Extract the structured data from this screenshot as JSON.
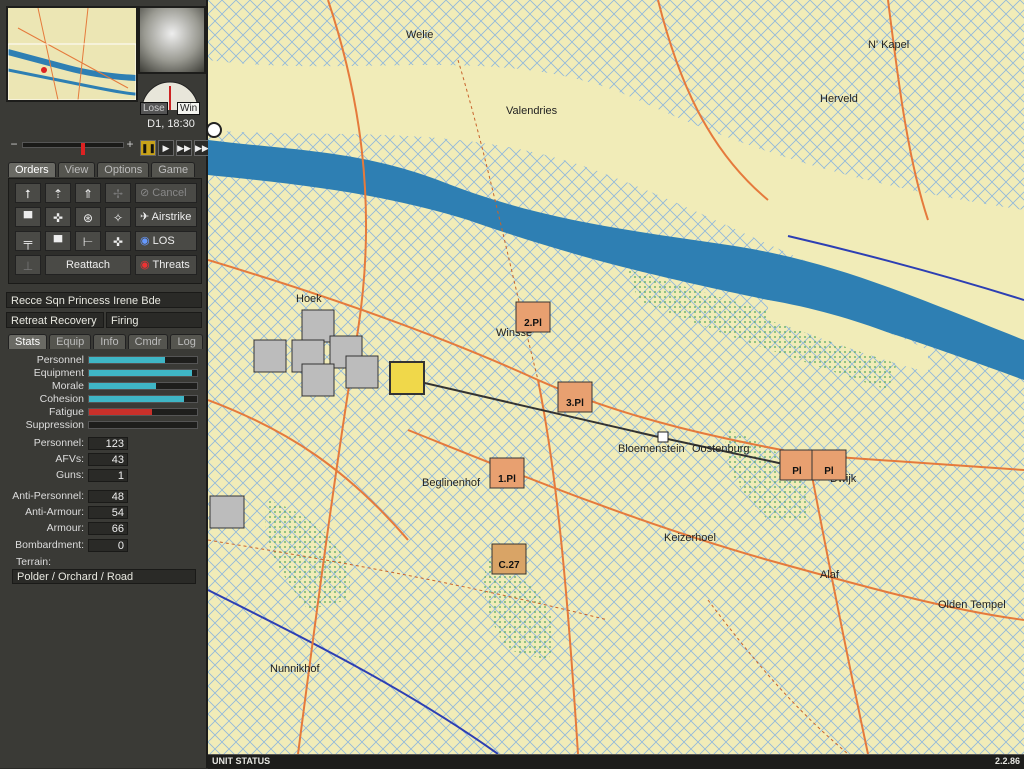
{
  "clock": {
    "datetime": "D1, 18:30",
    "lose_label": "Lose",
    "win_label": "Win"
  },
  "time_controls": {
    "slider_minus": "−",
    "slider_plus": "+",
    "speeds": [
      "❚❚",
      "▶",
      "▶▶",
      "▶▶▶"
    ],
    "active_speed": 0,
    "slider_value_pct": 58
  },
  "main_tabs": [
    "Orders",
    "View",
    "Options",
    "Game"
  ],
  "orders": {
    "icon_buttons": [
      "⭡",
      "⇡",
      "⇑",
      "✢",
      "▀",
      "✜",
      "⊛",
      "✧",
      "╤",
      "▀",
      "⊢",
      "✜",
      "⊥"
    ],
    "cancel": "Cancel",
    "airstrike": "Airstrike",
    "los": "LOS",
    "threats": "Threats",
    "reattach": "Reattach"
  },
  "unit": {
    "name": "Recce Sqn Princess Irene Bde",
    "status_left": "Retreat Recovery",
    "status_right": "Firing"
  },
  "detail_tabs": [
    "Stats",
    "Equip",
    "Info",
    "Cmdr",
    "Log"
  ],
  "stats": [
    {
      "label": "Personnel",
      "value": 0.7,
      "color": "#3fb6c6"
    },
    {
      "label": "Equipment",
      "value": 0.95,
      "color": "#3fb6c6"
    },
    {
      "label": "Morale",
      "value": 0.62,
      "color": "#3fb6c6"
    },
    {
      "label": "Cohesion",
      "value": 0.88,
      "color": "#3fb6c6"
    },
    {
      "label": "Fatigue",
      "value": 0.58,
      "color": "#c9302a"
    },
    {
      "label": "Suppression",
      "value": 0.0,
      "color": "#3fb6c6"
    }
  ],
  "numbers": [
    {
      "label": "Personnel:",
      "value": "123"
    },
    {
      "label": "AFVs:",
      "value": "43"
    },
    {
      "label": "Guns:",
      "value": "1"
    },
    {
      "label": "Anti-Personnel:",
      "value": "48"
    },
    {
      "label": "Anti-Armour:",
      "value": "54"
    },
    {
      "label": "Armour:",
      "value": "66"
    },
    {
      "label": "Bombardment:",
      "value": "0"
    }
  ],
  "terrain": {
    "label": "Terrain:",
    "value": "Polder / Orchard / Road"
  },
  "map": {
    "places": [
      "Welie",
      "N' Kapel",
      "Valendries",
      "Herveld",
      "Hoek",
      "Winsse",
      "Bloemenstein",
      "Oostenburg",
      "Beglinenhof",
      "Keizerhoel",
      "Alaf",
      "Olden Tempel",
      "Nunnikhof",
      "Dwijk"
    ],
    "units": [
      {
        "label": "2.Pl",
        "color": "#e8a070"
      },
      {
        "label": "3.Pl",
        "color": "#e8a070"
      },
      {
        "label": "1.Pl",
        "color": "#e8a070"
      },
      {
        "label": "C.27",
        "color": "#d9a466"
      },
      {
        "label": "Pl",
        "color": "#e8a070"
      },
      {
        "label": "Pl",
        "color": "#e8a070"
      }
    ],
    "colors": {
      "land": "#f1ecb8",
      "water": "#2e7fb3",
      "road": "#e57a3c",
      "grid": "#a9c8e0"
    }
  },
  "statusbar": {
    "left": "UNIT STATUS",
    "right": "2.2.86"
  }
}
